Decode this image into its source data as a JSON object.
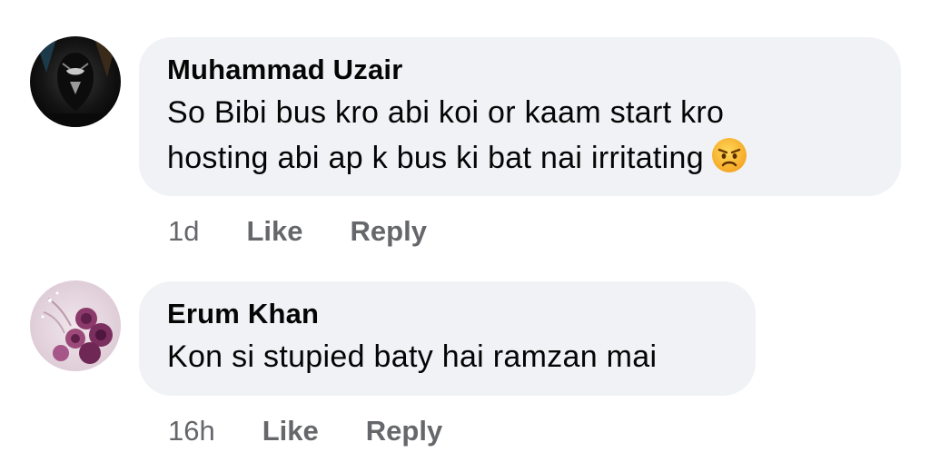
{
  "comments": [
    {
      "author": "Muhammad Uzair",
      "text": "So Bibi bus kro abi koi or kaam start kro hosting abi ap k bus ki bat nai irritating",
      "line1": "So Bibi bus kro abi koi or kaam start kro",
      "line2": "hosting abi ap k bus ki bat nai irritating",
      "emoji": "angry-face-icon",
      "time": "1d",
      "like_label": "Like",
      "reply_label": "Reply"
    },
    {
      "author": "Erum Khan",
      "text": "Kon si stupied baty hai ramzan mai",
      "time": "16h",
      "like_label": "Like",
      "reply_label": "Reply"
    }
  ],
  "colors": {
    "bubble": "#f0f2f5",
    "meta_text": "#65676b",
    "primary_text": "#050505"
  }
}
